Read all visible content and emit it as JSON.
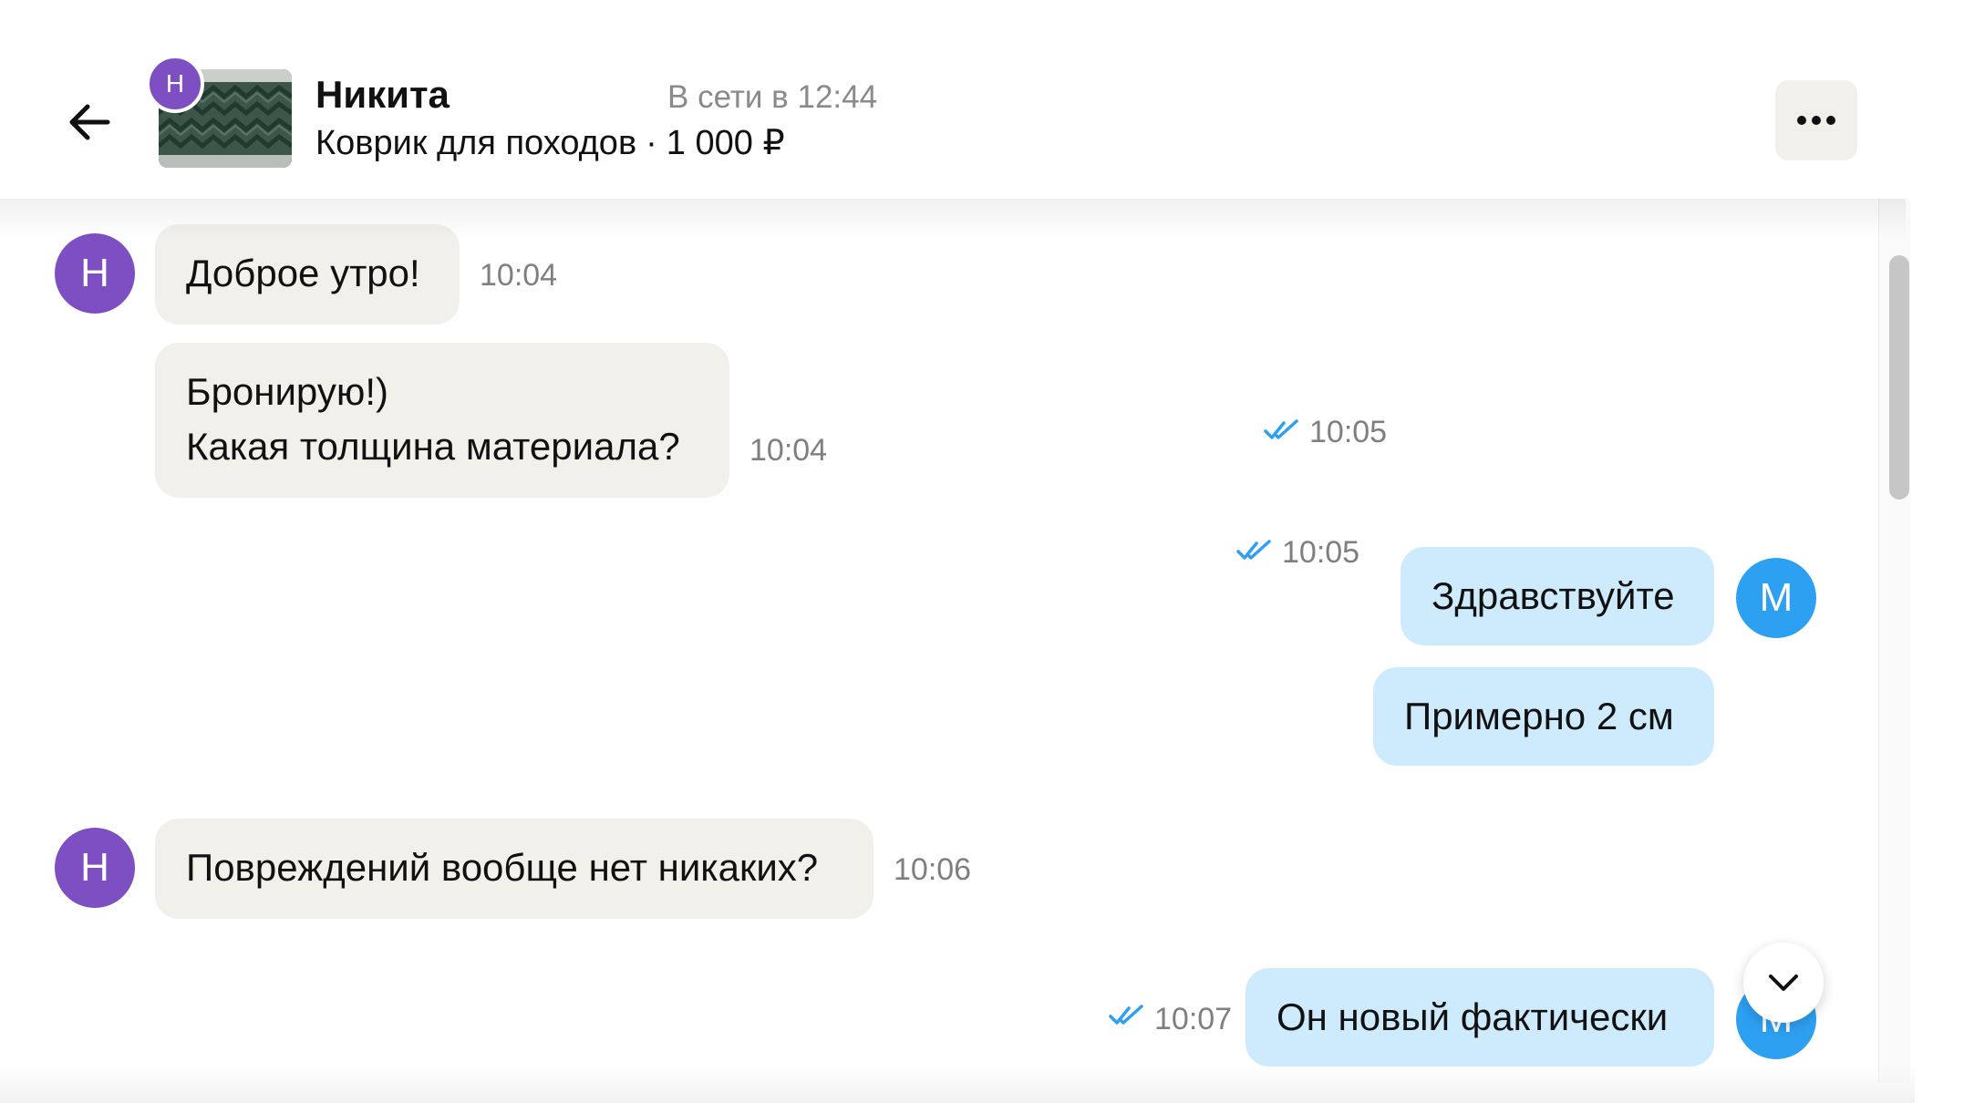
{
  "header": {
    "avatar_letter": "Н",
    "contact_name": "Никита",
    "online_status": "В сети в 12:44",
    "product_title": "Коврик для походов",
    "separator": "·",
    "product_price": "1 000 ₽"
  },
  "messages": [
    {
      "direction": "in",
      "text": "Доброе утро!",
      "time": "10:04",
      "avatar": "Н"
    },
    {
      "direction": "in",
      "text_lines": [
        "Бронирую!)",
        "Какая толщина материала?"
      ],
      "time": "10:04"
    },
    {
      "direction": "out",
      "text": "Здравствуйте",
      "time": "10:05",
      "avatar": "М",
      "read": true
    },
    {
      "direction": "out",
      "text": "Примерно 2 см",
      "time": "10:05",
      "read": true
    },
    {
      "direction": "in",
      "text": "Повреждений вообще нет никаких?",
      "time": "10:06",
      "avatar": "Н"
    },
    {
      "direction": "out",
      "text": "Он новый фактически",
      "time": "10:07",
      "avatar": "М",
      "read": true
    }
  ],
  "icons": {
    "back": "arrow-left-icon",
    "more": "ellipsis-icon",
    "read": "double-check-icon",
    "scroll_down": "chevron-down-icon"
  },
  "colors": {
    "incoming_bubble": "#f2f0eb",
    "outgoing_bubble": "#cdebfd",
    "avatar_seller": "#7e4fc3",
    "avatar_self": "#2ea0f2",
    "read_check": "#2ea0f2"
  }
}
